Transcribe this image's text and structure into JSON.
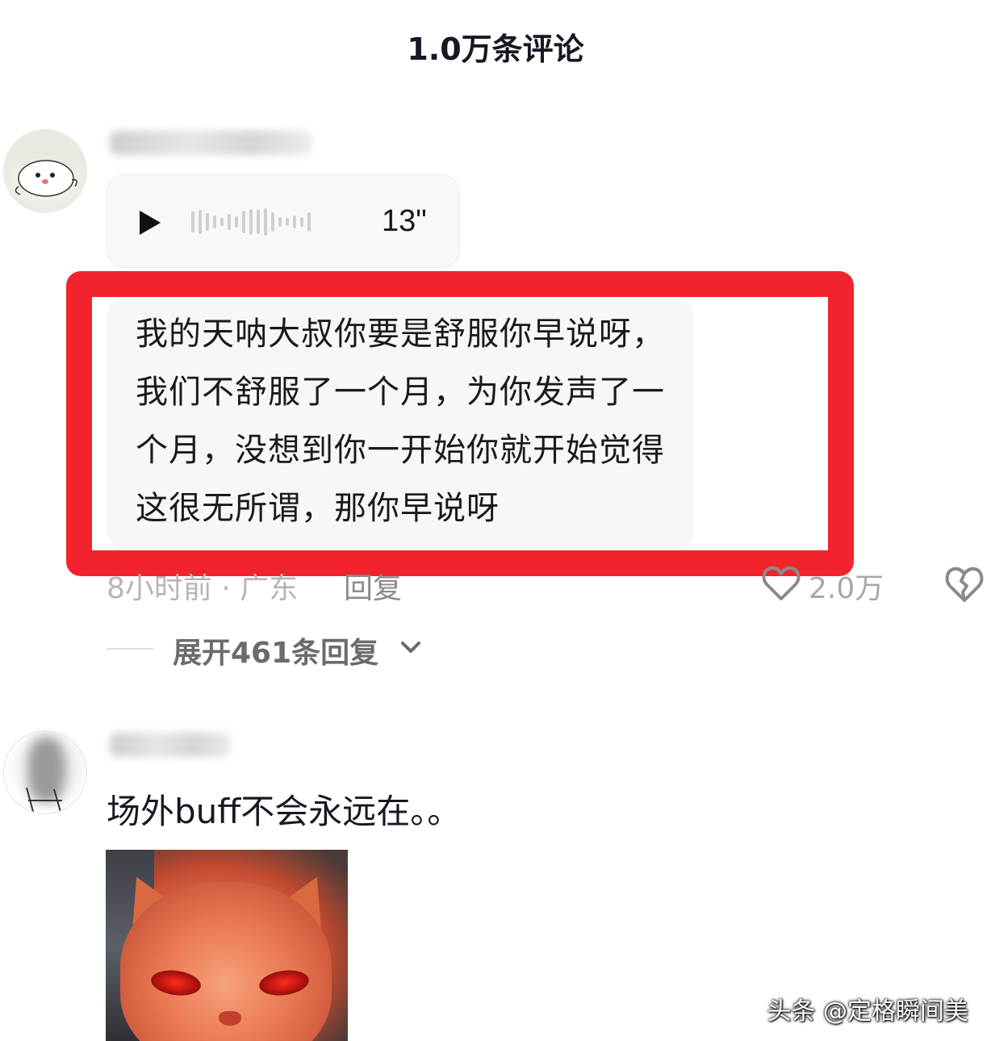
{
  "header": {
    "title": "1.0万条评论"
  },
  "comments": [
    {
      "voice": {
        "duration": "13\""
      },
      "text": "我的天呐大叔你要是舒服你早说呀，我们不舒服了一个月，为你发声了一个月，没想到你一开始你就开始觉得这很无所谓，那你早说呀",
      "time_location": "8小时前 · 广东",
      "reply_label": "回复",
      "like_count": "2.0万",
      "expand_label": "展开461条回复"
    },
    {
      "text": "场外buff不会永远在。。"
    }
  ],
  "watermark": "头条 @定格瞬间美",
  "colors": {
    "highlight": "#f2232d",
    "text": "#161823",
    "muted": "#b5b5b5"
  }
}
